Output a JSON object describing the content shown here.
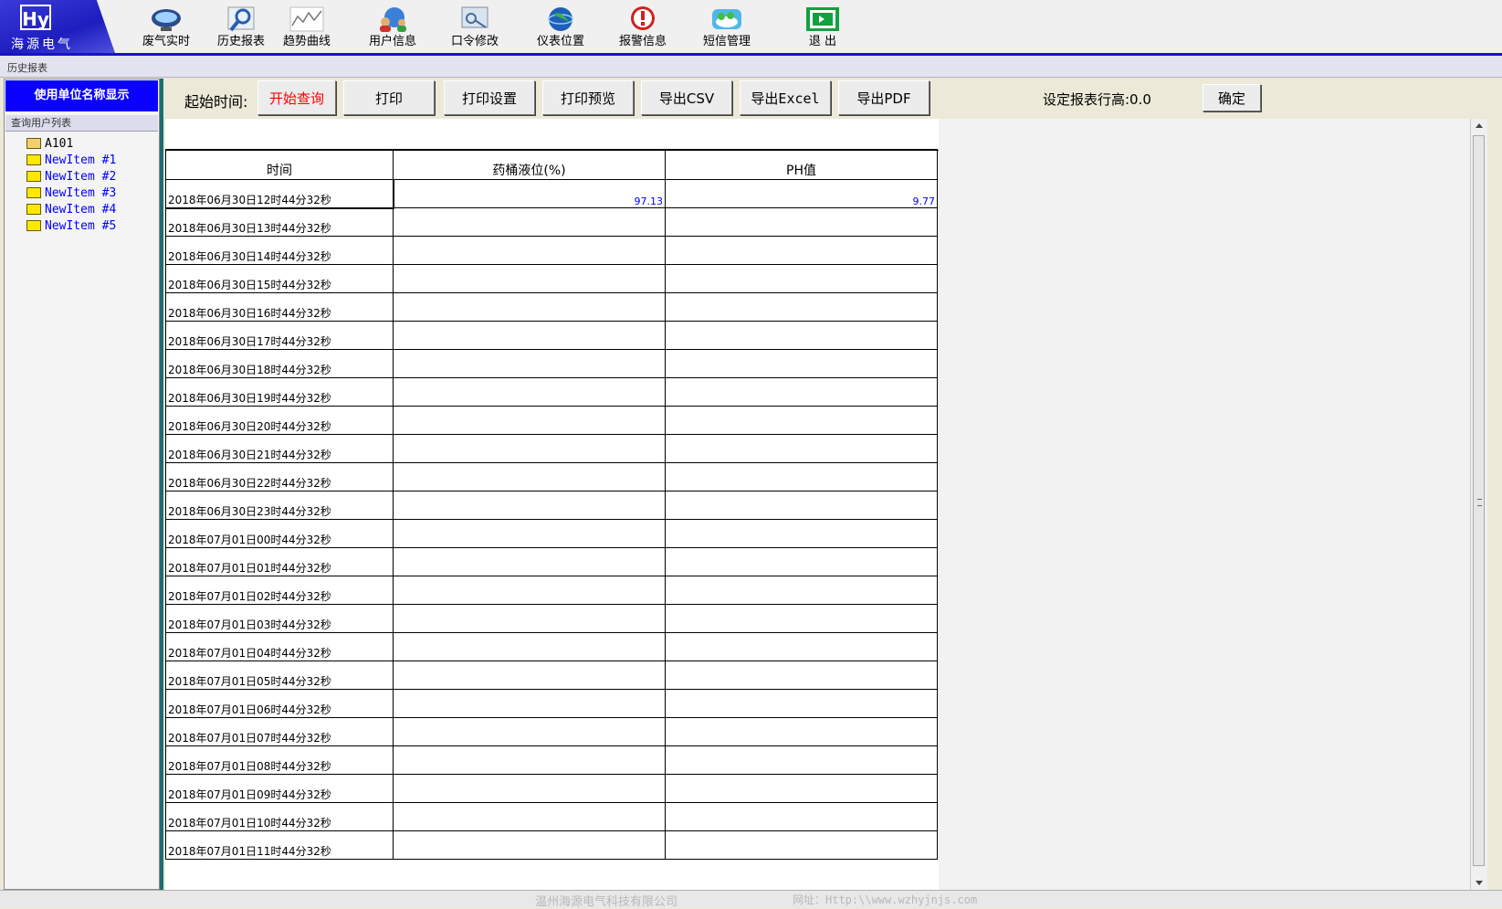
{
  "logo": {
    "mark": "Hy",
    "name": "海源电气"
  },
  "toolbar": {
    "items": [
      {
        "label": "废气实时"
      },
      {
        "label": "历史报表"
      },
      {
        "label": "趋势曲线"
      },
      {
        "label": "用户信息"
      },
      {
        "label": "口令修改"
      },
      {
        "label": "仪表位置"
      },
      {
        "label": "报警信息"
      },
      {
        "label": "短信管理"
      },
      {
        "label": "退  出"
      }
    ]
  },
  "page_title": "历史报表",
  "left_panel": {
    "unit_banner": "使用单位名称显示",
    "user_list_label": "查询用户列表",
    "tree": [
      {
        "label": "A101"
      },
      {
        "label": "NewItem #1"
      },
      {
        "label": "NewItem #2"
      },
      {
        "label": "NewItem #3"
      },
      {
        "label": "NewItem #4"
      },
      {
        "label": "NewItem #5"
      }
    ]
  },
  "actions": {
    "start_time_label": "起始时间:",
    "start_query": "开始查询",
    "print": "打印",
    "print_settings": "打印设置",
    "print_preview": "打印预览",
    "export_csv": "导出CSV",
    "export_excel": "导出Excel",
    "export_pdf": "导出PDF",
    "row_height_label": "设定报表行高:0.0",
    "confirm": "确定"
  },
  "colors": {
    "accent_blue": "#0a00ff",
    "query_red": "#ff0000",
    "value_blue": "#0000ff",
    "separator_teal": "#1a6f70"
  },
  "table": {
    "headers": [
      "时间",
      "药桶液位(%)",
      "PH值"
    ],
    "rows": [
      {
        "time": "2018年06月30日12时44分32秒",
        "level": "97.13",
        "ph": "9.77"
      },
      {
        "time": "2018年06月30日13时44分32秒",
        "level": "",
        "ph": ""
      },
      {
        "time": "2018年06月30日14时44分32秒",
        "level": "",
        "ph": ""
      },
      {
        "time": "2018年06月30日15时44分32秒",
        "level": "",
        "ph": ""
      },
      {
        "time": "2018年06月30日16时44分32秒",
        "level": "",
        "ph": ""
      },
      {
        "time": "2018年06月30日17时44分32秒",
        "level": "",
        "ph": ""
      },
      {
        "time": "2018年06月30日18时44分32秒",
        "level": "",
        "ph": ""
      },
      {
        "time": "2018年06月30日19时44分32秒",
        "level": "",
        "ph": ""
      },
      {
        "time": "2018年06月30日20时44分32秒",
        "level": "",
        "ph": ""
      },
      {
        "time": "2018年06月30日21时44分32秒",
        "level": "",
        "ph": ""
      },
      {
        "time": "2018年06月30日22时44分32秒",
        "level": "",
        "ph": ""
      },
      {
        "time": "2018年06月30日23时44分32秒",
        "level": "",
        "ph": ""
      },
      {
        "time": "2018年07月01日00时44分32秒",
        "level": "",
        "ph": ""
      },
      {
        "time": "2018年07月01日01时44分32秒",
        "level": "",
        "ph": ""
      },
      {
        "time": "2018年07月01日02时44分32秒",
        "level": "",
        "ph": ""
      },
      {
        "time": "2018年07月01日03时44分32秒",
        "level": "",
        "ph": ""
      },
      {
        "time": "2018年07月01日04时44分32秒",
        "level": "",
        "ph": ""
      },
      {
        "time": "2018年07月01日05时44分32秒",
        "level": "",
        "ph": ""
      },
      {
        "time": "2018年07月01日06时44分32秒",
        "level": "",
        "ph": ""
      },
      {
        "time": "2018年07月01日07时44分32秒",
        "level": "",
        "ph": ""
      },
      {
        "time": "2018年07月01日08时44分32秒",
        "level": "",
        "ph": ""
      },
      {
        "time": "2018年07月01日09时44分32秒",
        "level": "",
        "ph": ""
      },
      {
        "time": "2018年07月01日10时44分32秒",
        "level": "",
        "ph": ""
      },
      {
        "time": "2018年07月01日11时44分32秒",
        "level": "",
        "ph": ""
      }
    ]
  },
  "footer": {
    "company": "温州海源电气科技有限公司",
    "website": "网址：Http:\\\\www.wzhyjnjs.com"
  }
}
